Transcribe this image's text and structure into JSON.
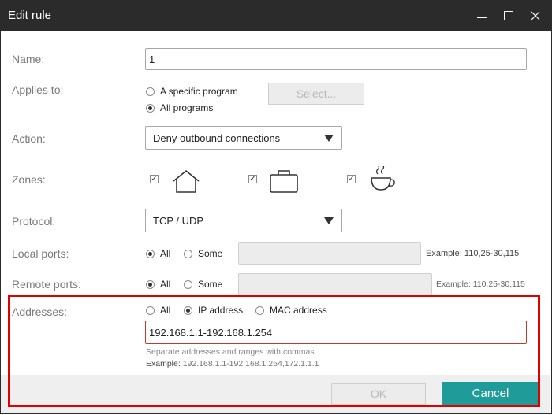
{
  "window": {
    "title": "Edit rule"
  },
  "form": {
    "name": {
      "label": "Name:",
      "value": "1"
    },
    "applies_to": {
      "label": "Applies to:",
      "options": [
        "A specific program",
        "All programs"
      ],
      "selected": 1,
      "select_button": "Select..."
    },
    "action": {
      "label": "Action:",
      "value": "Deny outbound connections"
    },
    "zones": {
      "label": "Zones:",
      "items": [
        {
          "icon": "home-icon",
          "checked": true
        },
        {
          "icon": "briefcase-icon",
          "checked": true
        },
        {
          "icon": "coffee-icon",
          "checked": true
        }
      ]
    },
    "protocol": {
      "label": "Protocol:",
      "value": "TCP / UDP"
    },
    "local_ports": {
      "label": "Local ports:",
      "options": [
        "All",
        "Some"
      ],
      "selected": 0,
      "example": "Example: 110,25-30,115"
    },
    "remote_ports": {
      "label": "Remote ports:",
      "options": [
        "All",
        "Some"
      ],
      "selected": 0,
      "example": "Example: 110,25-30,115"
    },
    "addresses": {
      "label": "Addresses:",
      "options": [
        "All",
        "IP address",
        "MAC address"
      ],
      "selected": 1,
      "value": "192.168.1.1-192.168.1.254",
      "hint": "Separate addresses and ranges with commas",
      "example_label": "Example:",
      "example_value": "192.168.1.1-192.168.1.254,172.1.1.1"
    }
  },
  "footer": {
    "ok_label": "OK",
    "cancel_label": "Cancel"
  },
  "colors": {
    "titlebar": "#2b2b2b",
    "accent": "#1f9b9a",
    "highlight": "#e00000"
  }
}
